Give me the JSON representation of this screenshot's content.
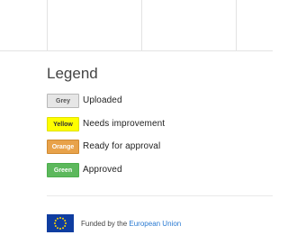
{
  "legend": {
    "title": "Legend",
    "items": [
      {
        "badge": "Grey",
        "label": "Uploaded"
      },
      {
        "badge": "Yellow",
        "label": "Needs improvement"
      },
      {
        "badge": "Orange",
        "label": "Ready for approval"
      },
      {
        "badge": "Green",
        "label": "Approved"
      }
    ]
  },
  "footer": {
    "funding_prefix": "Funded by the",
    "funding_link": "European Union",
    "flag_icon": "eu-flag-icon"
  },
  "colors": {
    "grey": "#e6e6e6",
    "yellow": "#ffff00",
    "orange": "#e8a24a",
    "green": "#5cb85c",
    "link": "#2a7ad2",
    "eu_blue": "#0f3da0",
    "eu_star": "#ffd500"
  }
}
